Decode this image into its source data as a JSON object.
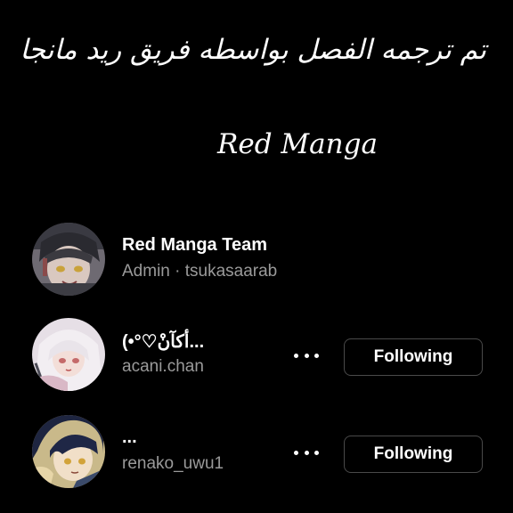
{
  "header": {
    "credit_line": "تم ترجمه الفصل بواسطه فريق ريد مانجا",
    "brand": "Red Manga"
  },
  "accounts": [
    {
      "name": "Red Manga Team",
      "subtitle": "Admin · tsukasaarab"
    },
    {
      "name": "(•°♡أكآنْ...",
      "subtitle": "acani.chan",
      "button": "Following"
    },
    {
      "name": "...",
      "subtitle": "renako_uwu1",
      "button": "Following"
    }
  ],
  "icons": {
    "more": "more-horizontal-icon"
  },
  "colors": {
    "background": "#000000",
    "text": "#ffffff",
    "muted": "#9a9a9a",
    "button_border": "#4a4a4a"
  }
}
